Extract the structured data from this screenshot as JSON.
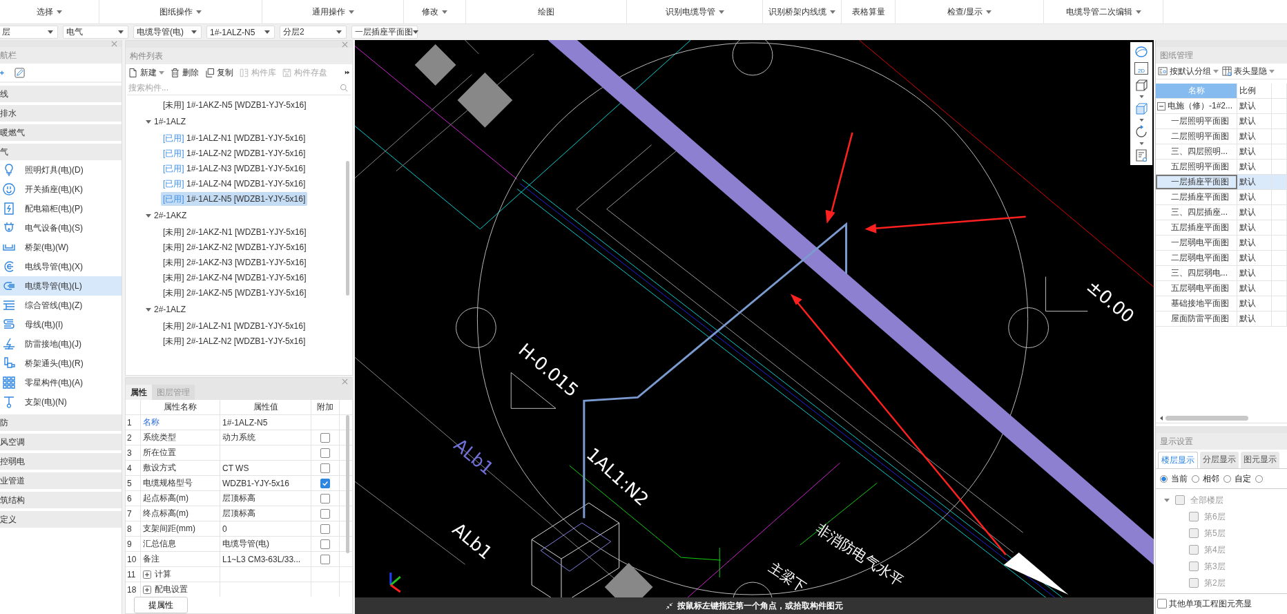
{
  "menu": [
    {
      "label": "选择",
      "dropdown": true
    },
    {
      "label": "图纸操作",
      "dropdown": true
    },
    {
      "label": "通用操作",
      "dropdown": true
    },
    {
      "label": "修改",
      "dropdown": true
    },
    {
      "label": "绘图",
      "dropdown": false
    },
    {
      "label": "识别电缆导管",
      "dropdown": true
    },
    {
      "label": "识别桥架内线缆",
      "dropdown": true
    },
    {
      "label": "表格算量",
      "dropdown": false
    },
    {
      "label": "检查/显示",
      "dropdown": true
    },
    {
      "label": "电缆导管二次编辑",
      "dropdown": true
    }
  ],
  "selectors": [
    "层",
    "电气",
    "电缆导管(电)",
    "1#-1ALZ-N5",
    "分层2",
    "一层插座平面图"
  ],
  "nav": {
    "title": "航栏",
    "categories": [
      {
        "label": "线"
      },
      {
        "label": "排水"
      },
      {
        "label": "暖燃气"
      },
      {
        "label": "气",
        "children": [
          {
            "label": "照明灯具(电)(D)",
            "selected": false
          },
          {
            "label": "开关插座(电)(K)",
            "selected": false
          },
          {
            "label": "配电箱柜(电)(P)",
            "selected": false
          },
          {
            "label": "电气设备(电)(S)",
            "selected": false
          },
          {
            "label": "桥架(电)(W)",
            "selected": false
          },
          {
            "label": "电线导管(电)(X)",
            "selected": false
          },
          {
            "label": "电缆导管(电)(L)",
            "selected": true
          },
          {
            "label": "综合管线(电)(Z)",
            "selected": false
          },
          {
            "label": "母线(电)(I)",
            "selected": false
          },
          {
            "label": "防雷接地(电)(J)",
            "selected": false
          },
          {
            "label": "桥架通头(电)(R)",
            "selected": false
          },
          {
            "label": "零星构件(电)(A)",
            "selected": false
          },
          {
            "label": "支架(电)(N)",
            "selected": false
          }
        ]
      },
      {
        "label": "防"
      },
      {
        "label": "风空调"
      },
      {
        "label": "控弱电"
      },
      {
        "label": "业管道"
      },
      {
        "label": "筑结构"
      },
      {
        "label": "定义"
      }
    ]
  },
  "component_list": {
    "title": "构件列表",
    "toolbar": [
      {
        "label": "新建",
        "disabled": false,
        "dropdown": true
      },
      {
        "label": "删除",
        "disabled": false,
        "dropdown": false
      },
      {
        "label": "复制",
        "disabled": false,
        "dropdown": false
      },
      {
        "label": "构件库",
        "disabled": true,
        "dropdown": false
      },
      {
        "label": "构件存盘",
        "disabled": true,
        "dropdown": false
      }
    ],
    "search": {
      "placeholder": "搜索构件..."
    },
    "tree": [
      {
        "kind": "item",
        "tag": "[未用]",
        "used": false,
        "name": "1#-1AKZ-N5 [WDZB1-YJY-5x16]",
        "selected": false
      },
      {
        "kind": "group",
        "label": "1#-1ALZ",
        "expanded": true,
        "children": [
          {
            "tag": "[已用]",
            "used": true,
            "name": "1#-1ALZ-N1 [WDZB1-YJY-5x16]",
            "selected": false
          },
          {
            "tag": "[已用]",
            "used": true,
            "name": "1#-1ALZ-N2 [WDZB1-YJY-5x16]",
            "selected": false
          },
          {
            "tag": "[已用]",
            "used": true,
            "name": "1#-1ALZ-N3 [WDZB1-YJY-5x16]",
            "selected": false
          },
          {
            "tag": "[已用]",
            "used": true,
            "name": "1#-1ALZ-N4 [WDZB1-YJY-5x16]",
            "selected": false
          },
          {
            "tag": "[已用]",
            "used": true,
            "name": "1#-1ALZ-N5 [WDZB1-YJY-5x16]",
            "selected": true
          }
        ]
      },
      {
        "kind": "group",
        "label": "2#-1AKZ",
        "expanded": true,
        "children": [
          {
            "tag": "[未用]",
            "used": false,
            "name": "2#-1AKZ-N1 [WDZB1-YJY-5x16]",
            "selected": false
          },
          {
            "tag": "[未用]",
            "used": false,
            "name": "2#-1AKZ-N2 [WDZB1-YJY-5x16]",
            "selected": false
          },
          {
            "tag": "[未用]",
            "used": false,
            "name": "2#-1AKZ-N3 [WDZB1-YJY-5x16]",
            "selected": false
          },
          {
            "tag": "[未用]",
            "used": false,
            "name": "2#-1AKZ-N4 [WDZB1-YJY-5x16]",
            "selected": false
          },
          {
            "tag": "[未用]",
            "used": false,
            "name": "2#-1AKZ-N5 [WDZB1-YJY-5x16]",
            "selected": false
          }
        ]
      },
      {
        "kind": "group",
        "label": "2#-1ALZ",
        "expanded": true,
        "children": [
          {
            "tag": "[未用]",
            "used": false,
            "name": "2#-1ALZ-N1 [WDZB1-YJY-5x16]",
            "selected": false
          },
          {
            "tag": "[未用]",
            "used": false,
            "name": "2#-1ALZ-N2 [WDZB1-YJY-5x16]",
            "selected": false
          }
        ]
      }
    ]
  },
  "properties": {
    "tabs": [
      {
        "label": "属性",
        "selected": true
      },
      {
        "label": "图层管理",
        "selected": false
      }
    ],
    "columns": [
      "属性名称",
      "属性值",
      "附加"
    ],
    "rows": [
      {
        "num": "1",
        "kind": "name",
        "name": "名称",
        "value": "1#-1ALZ-N5"
      },
      {
        "num": "2",
        "kind": "field",
        "name": "系统类型",
        "value": "动力系统",
        "checked": false
      },
      {
        "num": "3",
        "kind": "field",
        "name": "所在位置",
        "checked": false
      },
      {
        "num": "4",
        "kind": "field",
        "name": "敷设方式",
        "value": "CT WS",
        "checked": false
      },
      {
        "num": "5",
        "kind": "field",
        "name": "电缆规格型号",
        "value": "WDZB1-YJY-5x16",
        "checked": true
      },
      {
        "num": "6",
        "kind": "field",
        "name": "起点标高(m)",
        "value": "层顶标高",
        "checked": false
      },
      {
        "num": "7",
        "kind": "field",
        "name": "终点标高(m)",
        "value": "层顶标高",
        "checked": false
      },
      {
        "num": "8",
        "kind": "field",
        "name": "支架间距(mm)",
        "value": "0",
        "checked": false
      },
      {
        "num": "9",
        "kind": "field",
        "name": "汇总信息",
        "value": "电缆导管(电)",
        "checked": false
      },
      {
        "num": "10",
        "kind": "field",
        "name": "备注",
        "value": "L1~L3 CM3-63L/33...",
        "checked": false
      },
      {
        "num": "11",
        "kind": "group",
        "name": "计算",
        "expanded": false
      },
      {
        "num": "18",
        "kind": "group",
        "name": "配电设置",
        "expanded": false
      }
    ],
    "button": "提属性"
  },
  "canvas": {
    "view_label": "2D",
    "labels": [
      {
        "text": "H-0.015",
        "color": "#ffffff"
      },
      {
        "text": "1AL1:N2",
        "color": "#ffffff"
      },
      {
        "text": "ALb1",
        "color": "#7070d8"
      },
      {
        "text": "ALb1",
        "color": "#ffffff"
      },
      {
        "text": "±0.00",
        "color": "#ffffff"
      },
      {
        "text": "非消防电气水平",
        "color": "#ffffff"
      },
      {
        "text": "主梁下",
        "color": "#ffffff"
      }
    ],
    "status": "按鼠标左键指定第一个角点，或拾取构件图元"
  },
  "drawings": {
    "title": "图纸管理",
    "toolbar": [
      {
        "label": "按默认分组"
      },
      {
        "label": "表头显隐"
      }
    ],
    "columns": [
      "名称",
      "比例"
    ],
    "tree": {
      "name": "电施（修）-1#2...",
      "scale": "默认",
      "expanded": true,
      "children": [
        {
          "name": "一层照明平面图",
          "scale": "默认",
          "selected": false
        },
        {
          "name": "二层照明平面图",
          "scale": "默认",
          "selected": false
        },
        {
          "name": "三、四层照明...",
          "scale": "默认",
          "selected": false
        },
        {
          "name": "五层照明平面图",
          "scale": "默认",
          "selected": false
        },
        {
          "name": "一层插座平面图",
          "scale": "默认",
          "selected": true
        },
        {
          "name": "二层插座平面图",
          "scale": "默认",
          "selected": false
        },
        {
          "name": "三、四层插座...",
          "scale": "默认",
          "selected": false
        },
        {
          "name": "五层插座平面图",
          "scale": "默认",
          "selected": false
        },
        {
          "name": "一层弱电平面图",
          "scale": "默认",
          "selected": false
        },
        {
          "name": "二层弱电平面图",
          "scale": "默认",
          "selected": false
        },
        {
          "name": "三、四层弱电...",
          "scale": "默认",
          "selected": false
        },
        {
          "name": "五层弱电平面图",
          "scale": "默认",
          "selected": false
        },
        {
          "name": "基础接地平面图",
          "scale": "默认",
          "selected": false
        },
        {
          "name": "屋面防雷平面图",
          "scale": "默认",
          "selected": false
        }
      ]
    }
  },
  "display_settings": {
    "title": "显示设置",
    "tabs": [
      {
        "label": "楼层显示",
        "selected": true
      },
      {
        "label": "分层显示",
        "selected": false
      },
      {
        "label": "图元显示",
        "selected": false
      }
    ],
    "radios": [
      {
        "label": "当前",
        "selected": true
      },
      {
        "label": "相邻",
        "selected": false
      },
      {
        "label": "自定",
        "selected": false
      },
      {
        "selected": false
      }
    ],
    "floors": {
      "label": "全部楼层",
      "checked": false,
      "disabled": true,
      "expanded": true,
      "children": [
        {
          "label": "第6层",
          "checked": false
        },
        {
          "label": "第5层",
          "checked": false
        },
        {
          "label": "第4层",
          "checked": false
        },
        {
          "label": "第3层",
          "checked": false
        },
        {
          "label": "第2层",
          "checked": false
        }
      ]
    },
    "other_highlight": {
      "label": "其他单项工程图元亮显",
      "checked": false
    }
  }
}
